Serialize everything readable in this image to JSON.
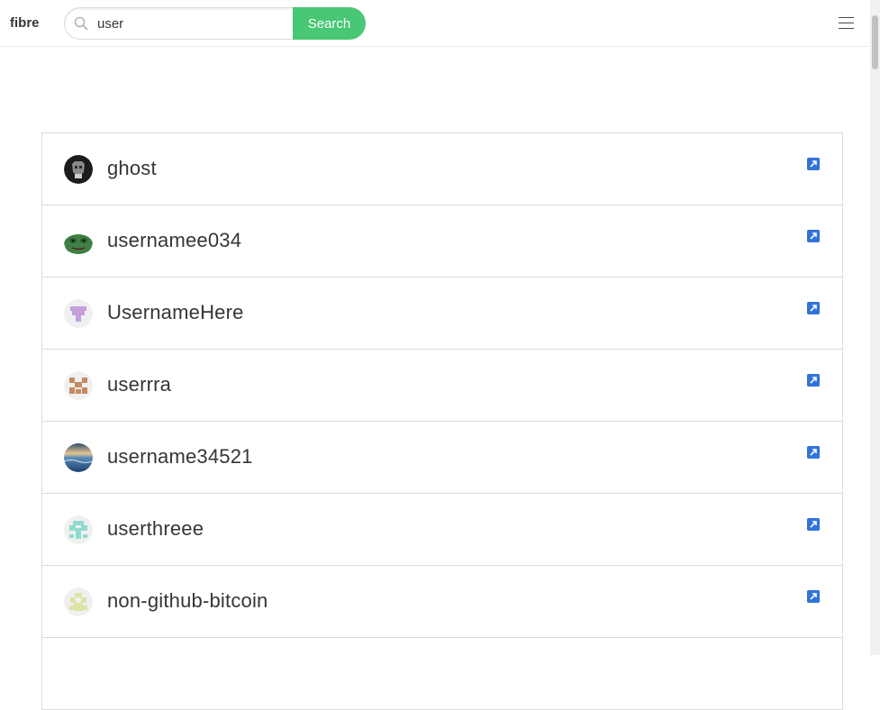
{
  "brand": "fibre",
  "search": {
    "value": "user",
    "button_label": "Search"
  },
  "results": [
    {
      "username": "ghost"
    },
    {
      "username": "usernamee034"
    },
    {
      "username": "UsernameHere"
    },
    {
      "username": "userrra"
    },
    {
      "username": "username34521"
    },
    {
      "username": "userthreee"
    },
    {
      "username": "non-github-bitcoin"
    }
  ],
  "colors": {
    "search_button": "#48c774",
    "link_icon": "#3273dc",
    "text": "#363636",
    "border": "#dbdbdb"
  },
  "icons": {
    "search": "search-icon",
    "menu": "hamburger-menu-icon",
    "external_link": "external-link-icon"
  }
}
